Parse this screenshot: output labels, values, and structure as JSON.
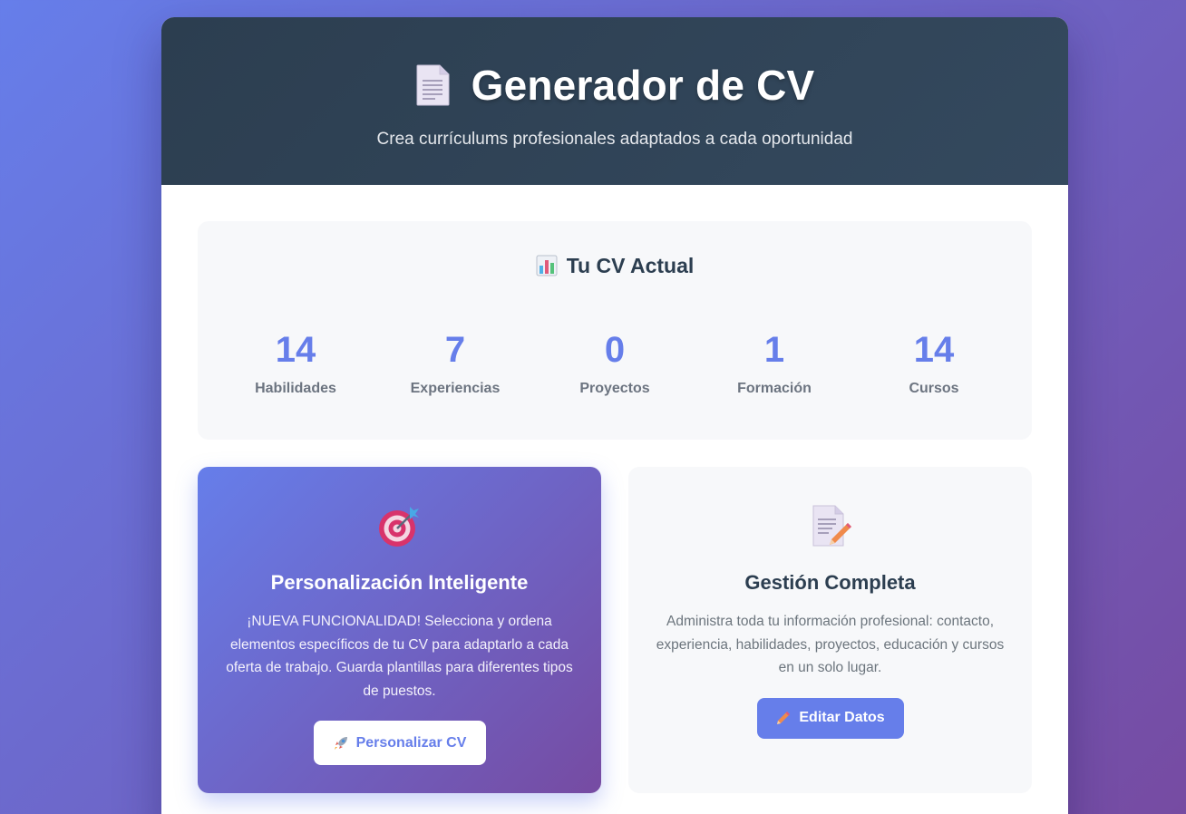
{
  "header": {
    "title": "Generador de CV",
    "subtitle": "Crea currículums profesionales adaptados a cada oportunidad",
    "icon": "document-icon"
  },
  "stats": {
    "title": "Tu CV Actual",
    "icon": "bar-chart-icon",
    "items": [
      {
        "value": "14",
        "label": "Habilidades"
      },
      {
        "value": "7",
        "label": "Experiencias"
      },
      {
        "value": "0",
        "label": "Proyectos"
      },
      {
        "value": "1",
        "label": "Formación"
      },
      {
        "value": "14",
        "label": "Cursos"
      }
    ]
  },
  "cards": [
    {
      "icon": "target-icon",
      "title": "Personalización Inteligente",
      "description": "¡NUEVA FUNCIONALIDAD! Selecciona y ordena elementos específicos de tu CV para adaptarlo a cada oferta de trabajo. Guarda plantillas para diferentes tipos de puestos.",
      "button_icon": "rocket-icon",
      "button_label": "Personalizar CV"
    },
    {
      "icon": "memo-icon",
      "title": "Gestión Completa",
      "description": "Administra toda tu información profesional: contacto, experiencia, habilidades, proyectos, educación y cursos en un solo lugar.",
      "button_icon": "pencil-icon",
      "button_label": "Editar Datos"
    }
  ],
  "colors": {
    "accent": "#667eea",
    "gradient_end": "#764ba2",
    "header_bg": "#2c3e50"
  }
}
